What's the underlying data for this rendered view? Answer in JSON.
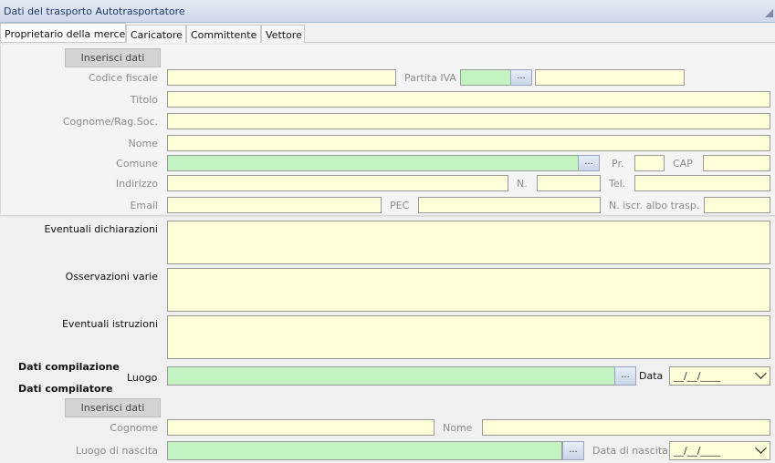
{
  "window": {
    "title": "Dati del trasporto Autotrasportatore"
  },
  "tabs": [
    {
      "label": "Proprietario della merce"
    },
    {
      "label": "Caricatore"
    },
    {
      "label": "Committente"
    },
    {
      "label": "Vettore"
    }
  ],
  "owner": {
    "insert_button": "Inserisci dati",
    "codice_fiscale_label": "Codice fiscale",
    "partita_iva_label": "Partita IVA",
    "titolo_label": "Titolo",
    "cognome_label": "Cognome/Rag.Soc.",
    "nome_label": "Nome",
    "comune_label": "Comune",
    "pr_label": "Pr.",
    "cap_label": "CAP",
    "indirizzo_label": "Indirizzo",
    "n_label": "N.",
    "tel_label": "Tel.",
    "email_label": "Email",
    "pec_label": "PEC",
    "albo_label": "N. iscr. albo trasp.",
    "dots": "..."
  },
  "notes": {
    "dichiarazioni_label": "Eventuali dichiarazioni",
    "osservazioni_label": "Osservazioni varie",
    "istruzioni_label": "Eventuali istruzioni"
  },
  "compilazione": {
    "section_label": "Dati compilazione",
    "luogo_label": "Luogo",
    "data_label": "Data",
    "data_value": "__/__/____",
    "dots": "..."
  },
  "compilatore": {
    "section_label": "Dati compilatore",
    "insert_button": "Inserisci dati",
    "cognome_label": "Cognome",
    "nome_label": "Nome",
    "luogo_nascita_label": "Luogo di nascita",
    "data_nascita_label": "Data di nascita",
    "data_nascita_value": "__/__/____",
    "dots": "..."
  },
  "colors": {
    "field_yellow": "#ffffd9",
    "field_green": "#c3f3c1",
    "header_text": "#1e3a68"
  },
  "icons": {
    "dropdown": "chevron-down-icon",
    "window": "window-triangle-icon"
  }
}
